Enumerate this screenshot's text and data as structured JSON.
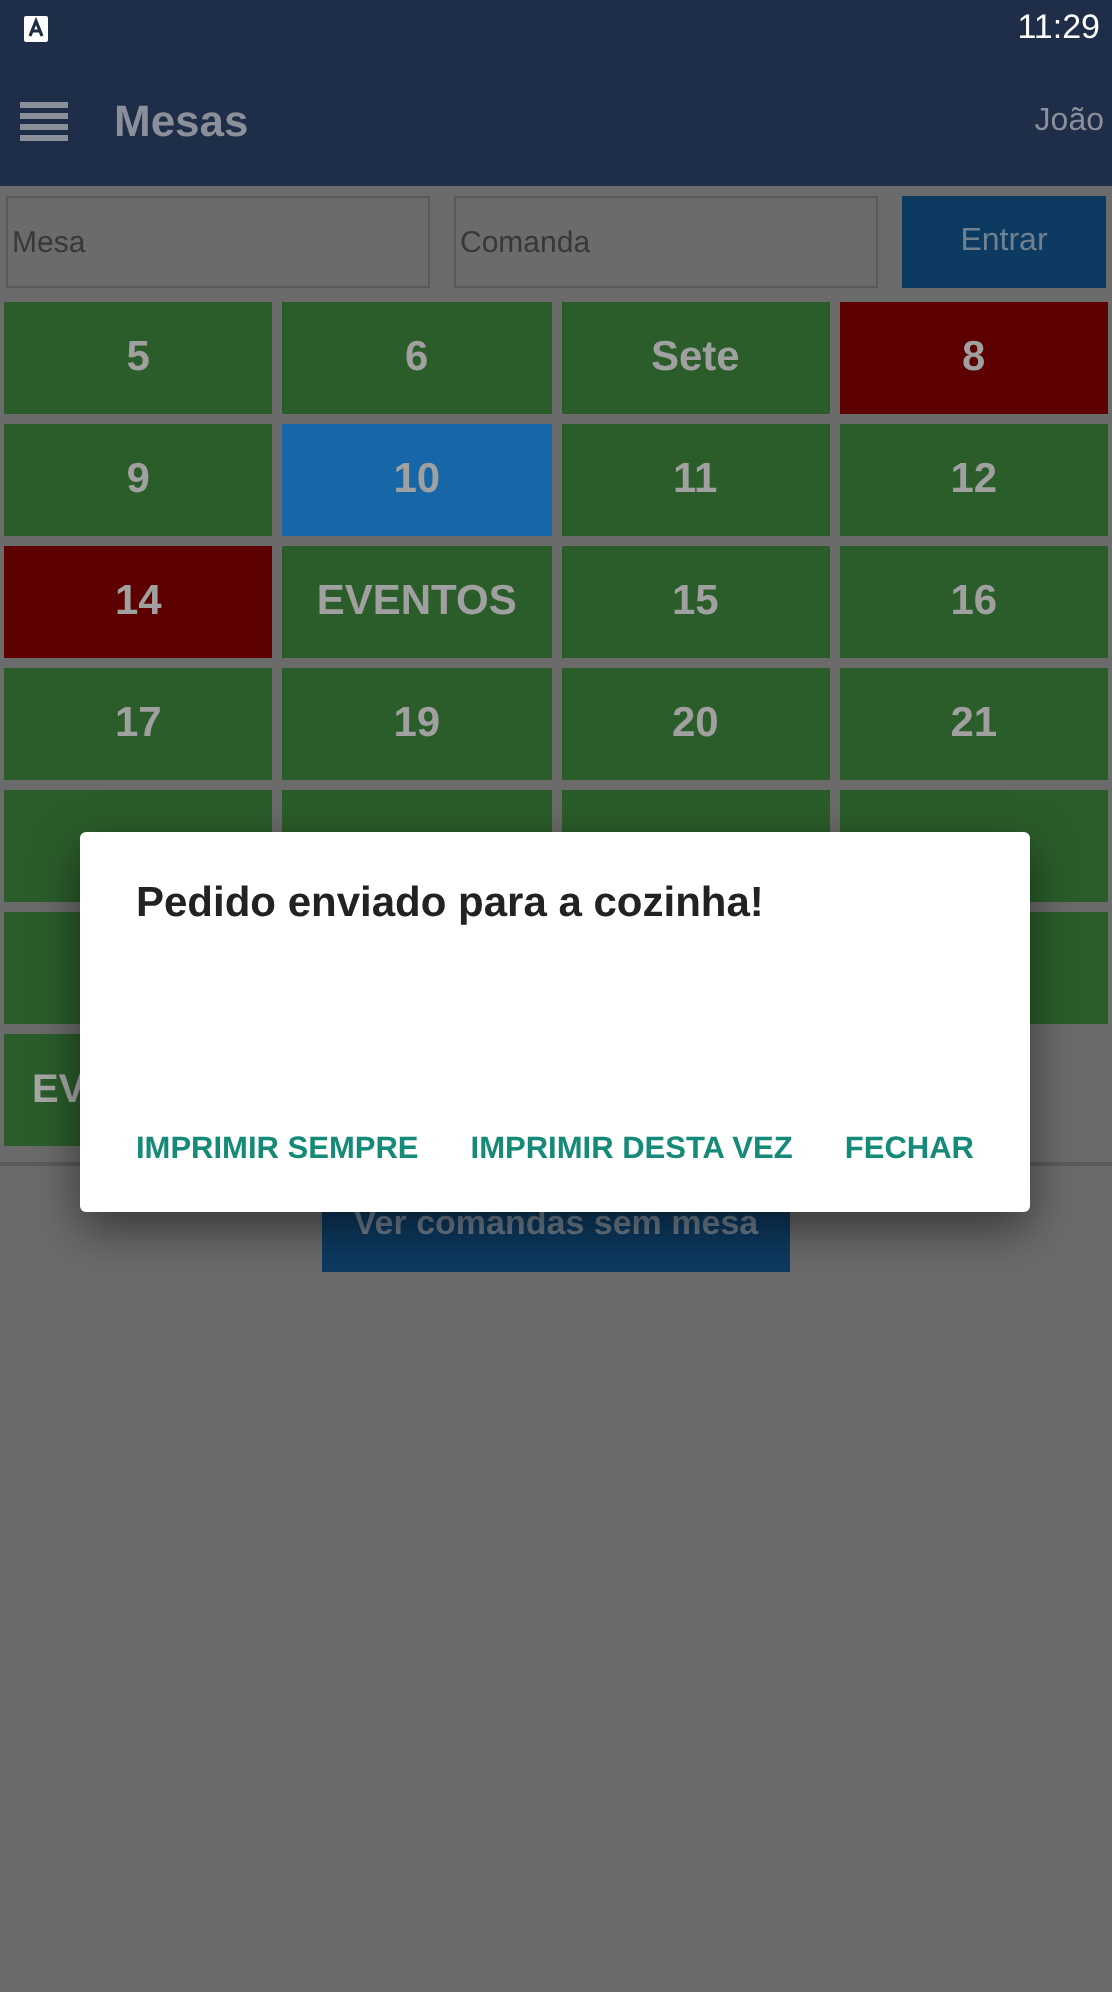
{
  "status_bar": {
    "time": "11:29"
  },
  "app_bar": {
    "title": "Mesas",
    "user": "João"
  },
  "search": {
    "mesa_placeholder": "Mesa",
    "comanda_placeholder": "Comanda",
    "button": "Entrar"
  },
  "tables": [
    {
      "label": "5",
      "color": "#2b5d2b"
    },
    {
      "label": "6",
      "color": "#2b5d2b"
    },
    {
      "label": "Sete",
      "color": "#2b5d2b"
    },
    {
      "label": "8",
      "color": "#5c0000"
    },
    {
      "label": "9",
      "color": "#2b5d2b"
    },
    {
      "label": "10",
      "color": "#1666a8"
    },
    {
      "label": "11",
      "color": "#2b5d2b"
    },
    {
      "label": "12",
      "color": "#2b5d2b"
    },
    {
      "label": "14",
      "color": "#5c0000"
    },
    {
      "label": "EVENTOS",
      "color": "#2b5d2b"
    },
    {
      "label": "15",
      "color": "#2b5d2b"
    },
    {
      "label": "16",
      "color": "#2b5d2b"
    },
    {
      "label": "17",
      "color": "#2b5d2b"
    },
    {
      "label": "19",
      "color": "#2b5d2b"
    },
    {
      "label": "20",
      "color": "#2b5d2b"
    },
    {
      "label": "21",
      "color": "#2b5d2b"
    },
    {
      "color": "#2b5d2b"
    },
    {
      "color": "#2b5d2b"
    },
    {
      "color": "#2b5d2b"
    },
    {
      "color": "#2b5d2b"
    },
    {
      "color": "#2b5d2b"
    },
    {
      "color": "#2b5d2b"
    },
    {
      "label": "EV",
      "color": "#2b5d2b",
      "cut": true
    }
  ],
  "no_table_button": "Ver comandas sem mesa",
  "dialog": {
    "message": "Pedido enviado para a cozinha!",
    "actions": [
      "IMPRIMIR SEMPRE",
      "IMPRIMIR DESTA VEZ",
      "FECHAR"
    ]
  }
}
